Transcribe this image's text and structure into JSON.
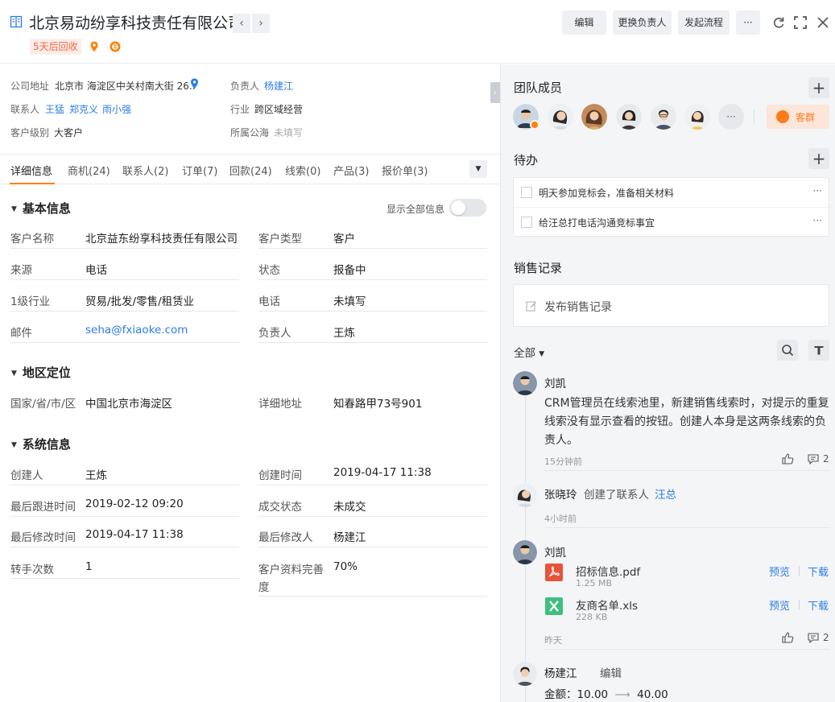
{
  "header": {
    "title": "北京易动纷享科技责任有限公司",
    "recycle_tag": "5天后回收",
    "buttons": {
      "edit": "编辑",
      "change_owner": "更换负责人",
      "start_flow": "发起流程",
      "more": "···"
    },
    "icons": [
      "company-icon",
      "prev-icon",
      "next-icon",
      "location-icon",
      "follow-icon",
      "refresh-icon",
      "fullscreen-icon",
      "close-icon"
    ]
  },
  "summary": {
    "address_label": "公司地址",
    "address_value": "北京市 海淀区中关村南大街 26..",
    "owner_label": "负责人",
    "owner_value": "杨建江",
    "contacts_label": "联系人",
    "contacts": [
      "王猛",
      "郑克义",
      "雨小强"
    ],
    "industry_label": "行业",
    "industry_value": "跨区域经营",
    "level_label": "客户级别",
    "level_value": "大客户",
    "pool_label": "所属公海",
    "pool_value": "未填写"
  },
  "tabs": [
    "详细信息",
    "商机(24)",
    "联系人(2)",
    "订单(7)",
    "回款(24)",
    "线索(0)",
    "产品(3)",
    "报价单(3)"
  ],
  "basic": {
    "title": "基本信息",
    "show_all": "显示全部信息",
    "fields": [
      {
        "label": "客户名称",
        "value": "北京益东纷享科技责任有限公司"
      },
      {
        "label": "客户类型",
        "value": "客户"
      },
      {
        "label": "来源",
        "value": "电话"
      },
      {
        "label": "状态",
        "value": "报备中"
      },
      {
        "label": "1级行业",
        "value": "贸易/批发/零售/租赁业"
      },
      {
        "label": "电话",
        "value": "未填写"
      },
      {
        "label": "邮件",
        "value": "seha@fxiaoke.com"
      },
      {
        "label": "负责人",
        "value": "王炼"
      }
    ]
  },
  "region": {
    "title": "地区定位",
    "fields": [
      {
        "label": "国家/省/市/区",
        "value": "中国北京市海淀区"
      },
      {
        "label": "详细地址",
        "value": "知春路甲73号901"
      }
    ]
  },
  "system": {
    "title": "系统信息",
    "fields": [
      {
        "label": "创建人",
        "value": "王炼"
      },
      {
        "label": "创建时间",
        "value": "2019-04-17 11:38"
      },
      {
        "label": "最后跟进时间",
        "value": "2019-02-12 09:20"
      },
      {
        "label": "成交状态",
        "value": "未成交"
      },
      {
        "label": "最后修改时间",
        "value": "2019-04-17 11:38"
      },
      {
        "label": "最后修改人",
        "value": "杨建江"
      },
      {
        "label": "转手次数",
        "value": "1"
      },
      {
        "label": "客户资料完善",
        "label2": "度",
        "value": "70%"
      }
    ]
  },
  "team": {
    "title": "团队成员",
    "more": "···",
    "group_label": "客群"
  },
  "todo": {
    "title": "待办",
    "items": [
      {
        "text": "明天参加竞标会，准备相关材料",
        "more": "···"
      },
      {
        "text": "给汪总打电话沟通竞标事宜",
        "more": "···"
      }
    ]
  },
  "sales": {
    "title": "销售记录",
    "publish": "发布销售记录",
    "filter": "全部",
    "feed": [
      {
        "author": "刘凯",
        "text": "CRM管理员在线索池里，新建销售线索时，对提示的重复线索没有显示查看的按钮。创建人本身是这两条线索的负责人。",
        "time": "15分钟前",
        "comments": "2"
      },
      {
        "author": "张晓玲",
        "action": "创建了联系人",
        "target": "汪总",
        "time": "4小时前"
      },
      {
        "author": "刘凯",
        "files": [
          {
            "name": "招标信息.pdf",
            "size": "1.25 MB",
            "preview": "预览",
            "download": "下载"
          },
          {
            "name": "友商名单.xls",
            "size": "228 KB",
            "preview": "预览",
            "download": "下载"
          }
        ],
        "time": "昨天",
        "comments": "2"
      },
      {
        "author": "杨建江",
        "action": "编辑",
        "amount_label": "金额：",
        "amount_from": "10.00",
        "amount_to": "40.00"
      }
    ]
  },
  "colors": {
    "accent": "#ff8000",
    "link": "#2b7de9",
    "tag_bg": "#fdecea",
    "tag_text": "#ee6a3d"
  }
}
